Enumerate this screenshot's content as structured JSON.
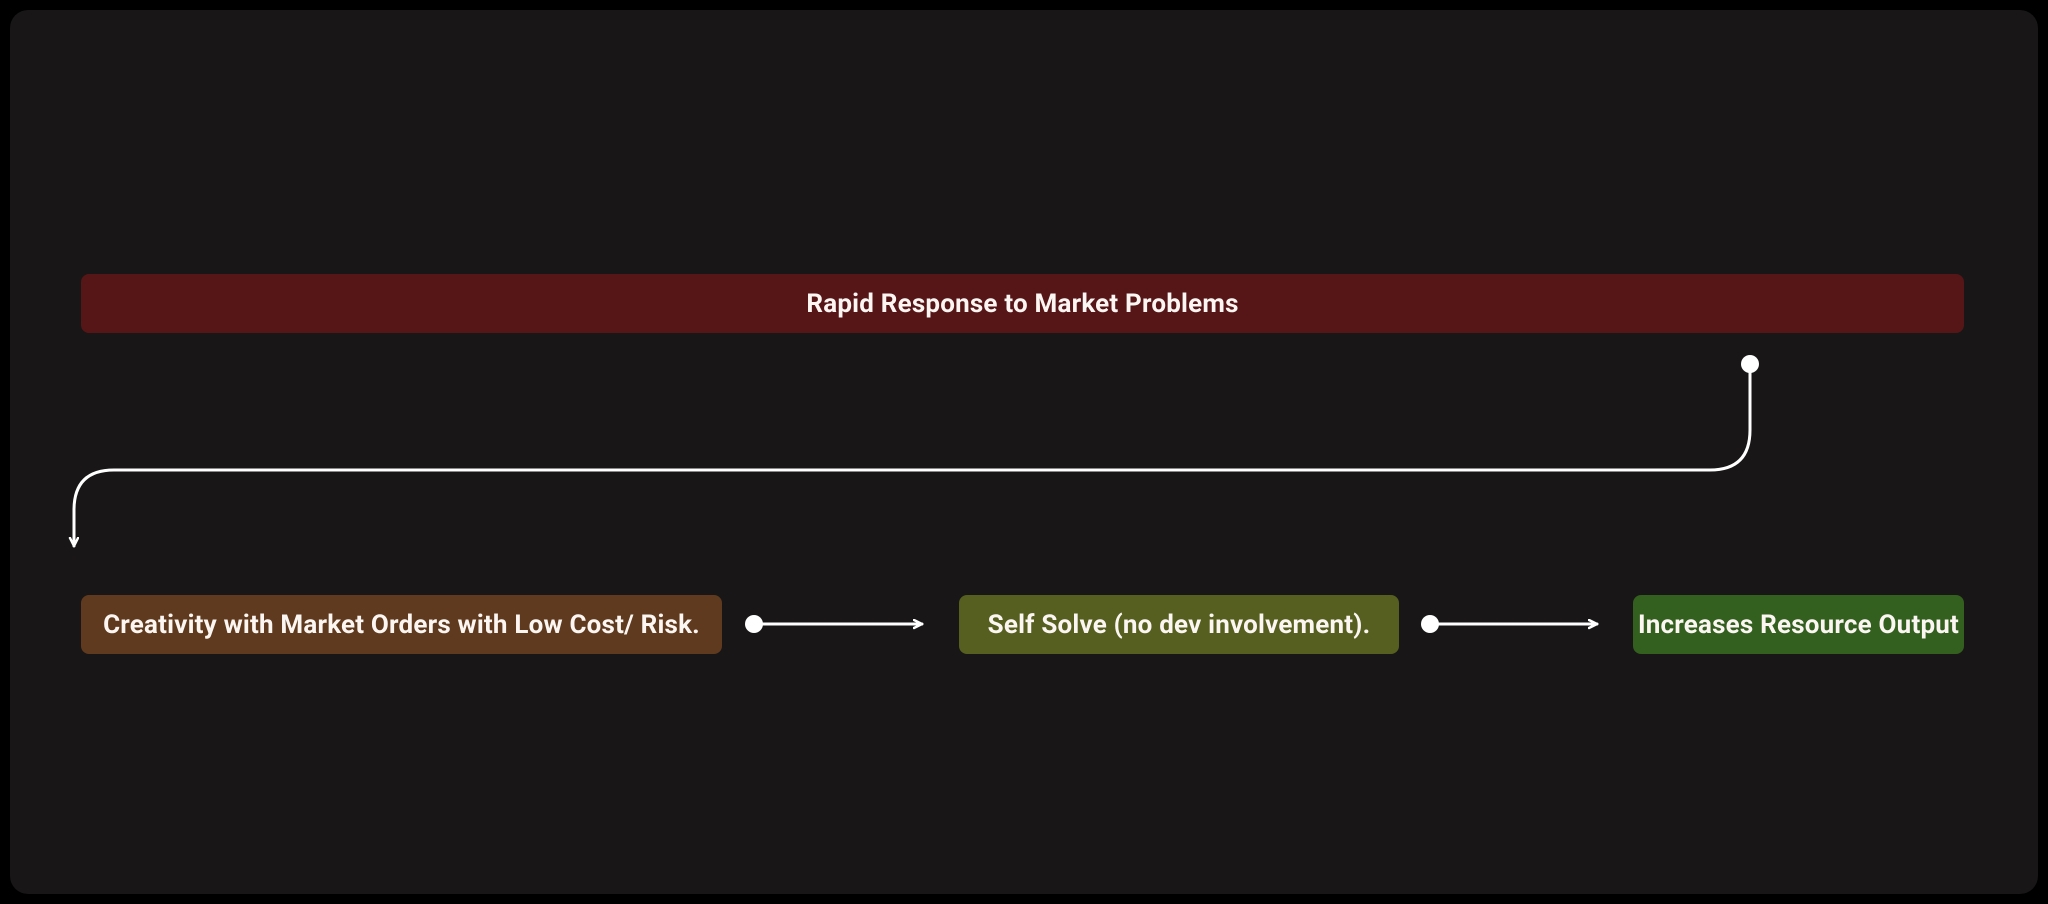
{
  "nodes": {
    "top": {
      "label": "Rapid Response to Market Problems",
      "color": "#561618"
    },
    "a": {
      "label": "Creativity with Market Orders with Low Cost/ Risk.",
      "color": "#5f3a1f"
    },
    "b": {
      "label": "Self Solve (no dev involvement).",
      "color": "#565f1f"
    },
    "c": {
      "label": "Increases Resource Output",
      "color": "#335f1f"
    }
  },
  "colors": {
    "canvas_bg": "#181616",
    "text": "#fbf6f2",
    "connector": "#ffffff"
  }
}
